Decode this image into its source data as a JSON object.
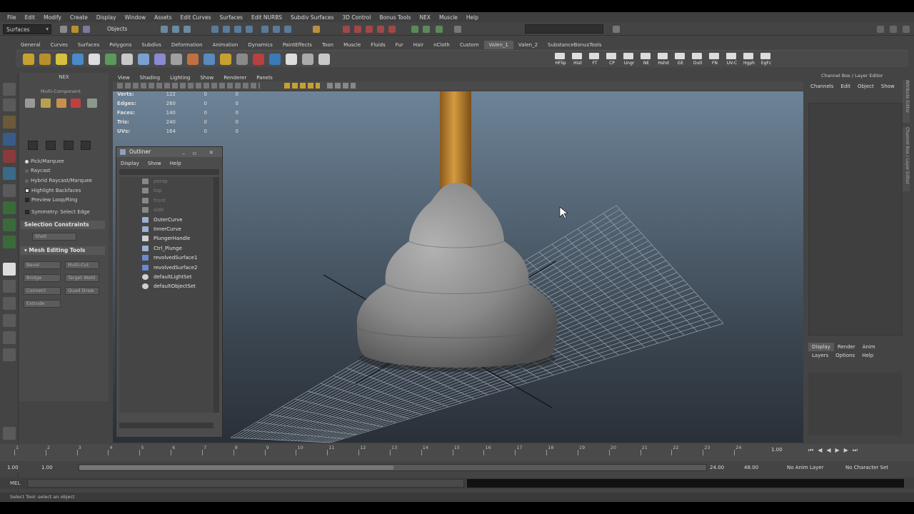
{
  "menubar": {
    "items": [
      "File",
      "Edit",
      "Modify",
      "Create",
      "Display",
      "Window",
      "Assets",
      "Edit Curves",
      "Surfaces",
      "Edit NURBS",
      "Subdiv Surfaces",
      "3D Control",
      "Bonus Tools",
      "NEX",
      "Muscle",
      "Help"
    ]
  },
  "statusline": {
    "mode": "Surfaces",
    "selection_mode": "Objects"
  },
  "shelf": {
    "tabs": [
      "General",
      "Curves",
      "Surfaces",
      "Polygons",
      "Subdivs",
      "Deformation",
      "Animation",
      "Dynamics",
      "PaintEffects",
      "Toon",
      "Muscle",
      "Fluids",
      "Fur",
      "Hair",
      "nCloth",
      "Custom",
      "Valen_1",
      "Valen_2",
      "SubstanceBonusTools"
    ],
    "active_tab": "Valen_1",
    "icon_labels": [
      "HFlip",
      "Hist",
      "FT",
      "CP",
      "Ungr",
      "NE",
      "Hshd",
      "GE",
      "Outl",
      "FN",
      "UV-C",
      "Hgph",
      "EgFc"
    ]
  },
  "toolpanel": {
    "header": "NEX",
    "component_label": "Multi-Component",
    "options": [
      "Pick/Marquee",
      "Raycast",
      "Hybrid Raycast/Marquee",
      "Highlight Backfaces",
      "Preview Loop/Ring",
      "Symmetry: Select Edge"
    ],
    "selection_constraints": "Selection Constraints",
    "shell": "Shell",
    "mesh_editing_tools": "Mesh Editing Tools",
    "tools": [
      "Bevel",
      "Multi-Cut",
      "Bridge",
      "Target Weld",
      "Connect",
      "Quad Draw",
      "Extrude"
    ]
  },
  "viewport": {
    "menu": [
      "View",
      "Shading",
      "Lighting",
      "Show",
      "Renderer",
      "Panels"
    ],
    "hud": [
      {
        "label": "Verts:",
        "value": "122",
        "a": "0",
        "b": "0"
      },
      {
        "label": "Edges:",
        "value": "260",
        "a": "0",
        "b": "0"
      },
      {
        "label": "Faces:",
        "value": "140",
        "a": "0",
        "b": "0"
      },
      {
        "label": "Tris:",
        "value": "240",
        "a": "0",
        "b": "0"
      },
      {
        "label": "UVs:",
        "value": "164",
        "a": "0",
        "b": "0"
      }
    ]
  },
  "outliner": {
    "title": "Outliner",
    "menu": [
      "Display",
      "Show",
      "Help"
    ],
    "items": [
      {
        "label": "persp",
        "dim": true,
        "icon": "camera"
      },
      {
        "label": "top",
        "dim": true,
        "icon": "camera"
      },
      {
        "label": "front",
        "dim": true,
        "icon": "camera"
      },
      {
        "label": "side",
        "dim": true,
        "icon": "camera"
      },
      {
        "label": "OuterCurve",
        "dim": false,
        "icon": "curve"
      },
      {
        "label": "InnerCurve",
        "dim": false,
        "icon": "curve"
      },
      {
        "label": "PlungerHandle",
        "dim": false,
        "icon": "mesh"
      },
      {
        "label": "Ctrl_Plunge",
        "dim": false,
        "icon": "curve"
      },
      {
        "label": "revolvedSurface1",
        "dim": false,
        "icon": "surface"
      },
      {
        "label": "revolvedSurface2",
        "dim": false,
        "icon": "surface"
      },
      {
        "label": "defaultLightSet",
        "dim": false,
        "icon": "set"
      },
      {
        "label": "defaultObjectSet",
        "dim": false,
        "icon": "set"
      }
    ]
  },
  "channelbox": {
    "title": "Channel Box / Layer Editor",
    "menu": [
      "Channels",
      "Edit",
      "Object",
      "Show"
    ],
    "layer_tabs": [
      "Display",
      "Render",
      "Anim"
    ],
    "layer_menu": [
      "Layers",
      "Options",
      "Help"
    ],
    "side_tabs": [
      "Attribute Editor",
      "Channel Box / Layer Editor"
    ]
  },
  "timeline": {
    "ticks": [
      "1",
      "2",
      "3",
      "4",
      "5",
      "6",
      "7",
      "8",
      "9",
      "10",
      "11",
      "12",
      "13",
      "14",
      "15",
      "16",
      "17",
      "18",
      "19",
      "20",
      "21",
      "22",
      "23",
      "24"
    ],
    "current_frame": "1.00"
  },
  "range": {
    "start": "1.00",
    "start2": "1.00",
    "slider_start": "1",
    "slider_end": "24",
    "end": "24.00",
    "end2": "48.00",
    "anim_layer": "No Anim Layer",
    "char_set": "No Character Set"
  },
  "cmdline": {
    "label": "MEL"
  },
  "helpline": {
    "text": "Select Tool: select an object"
  },
  "colors": {
    "viewport_top": "#6d8397",
    "viewport_bottom": "#2a3038",
    "handle": "#c8892e",
    "cup": "#8a8a8a",
    "accent": "#5285a6"
  }
}
